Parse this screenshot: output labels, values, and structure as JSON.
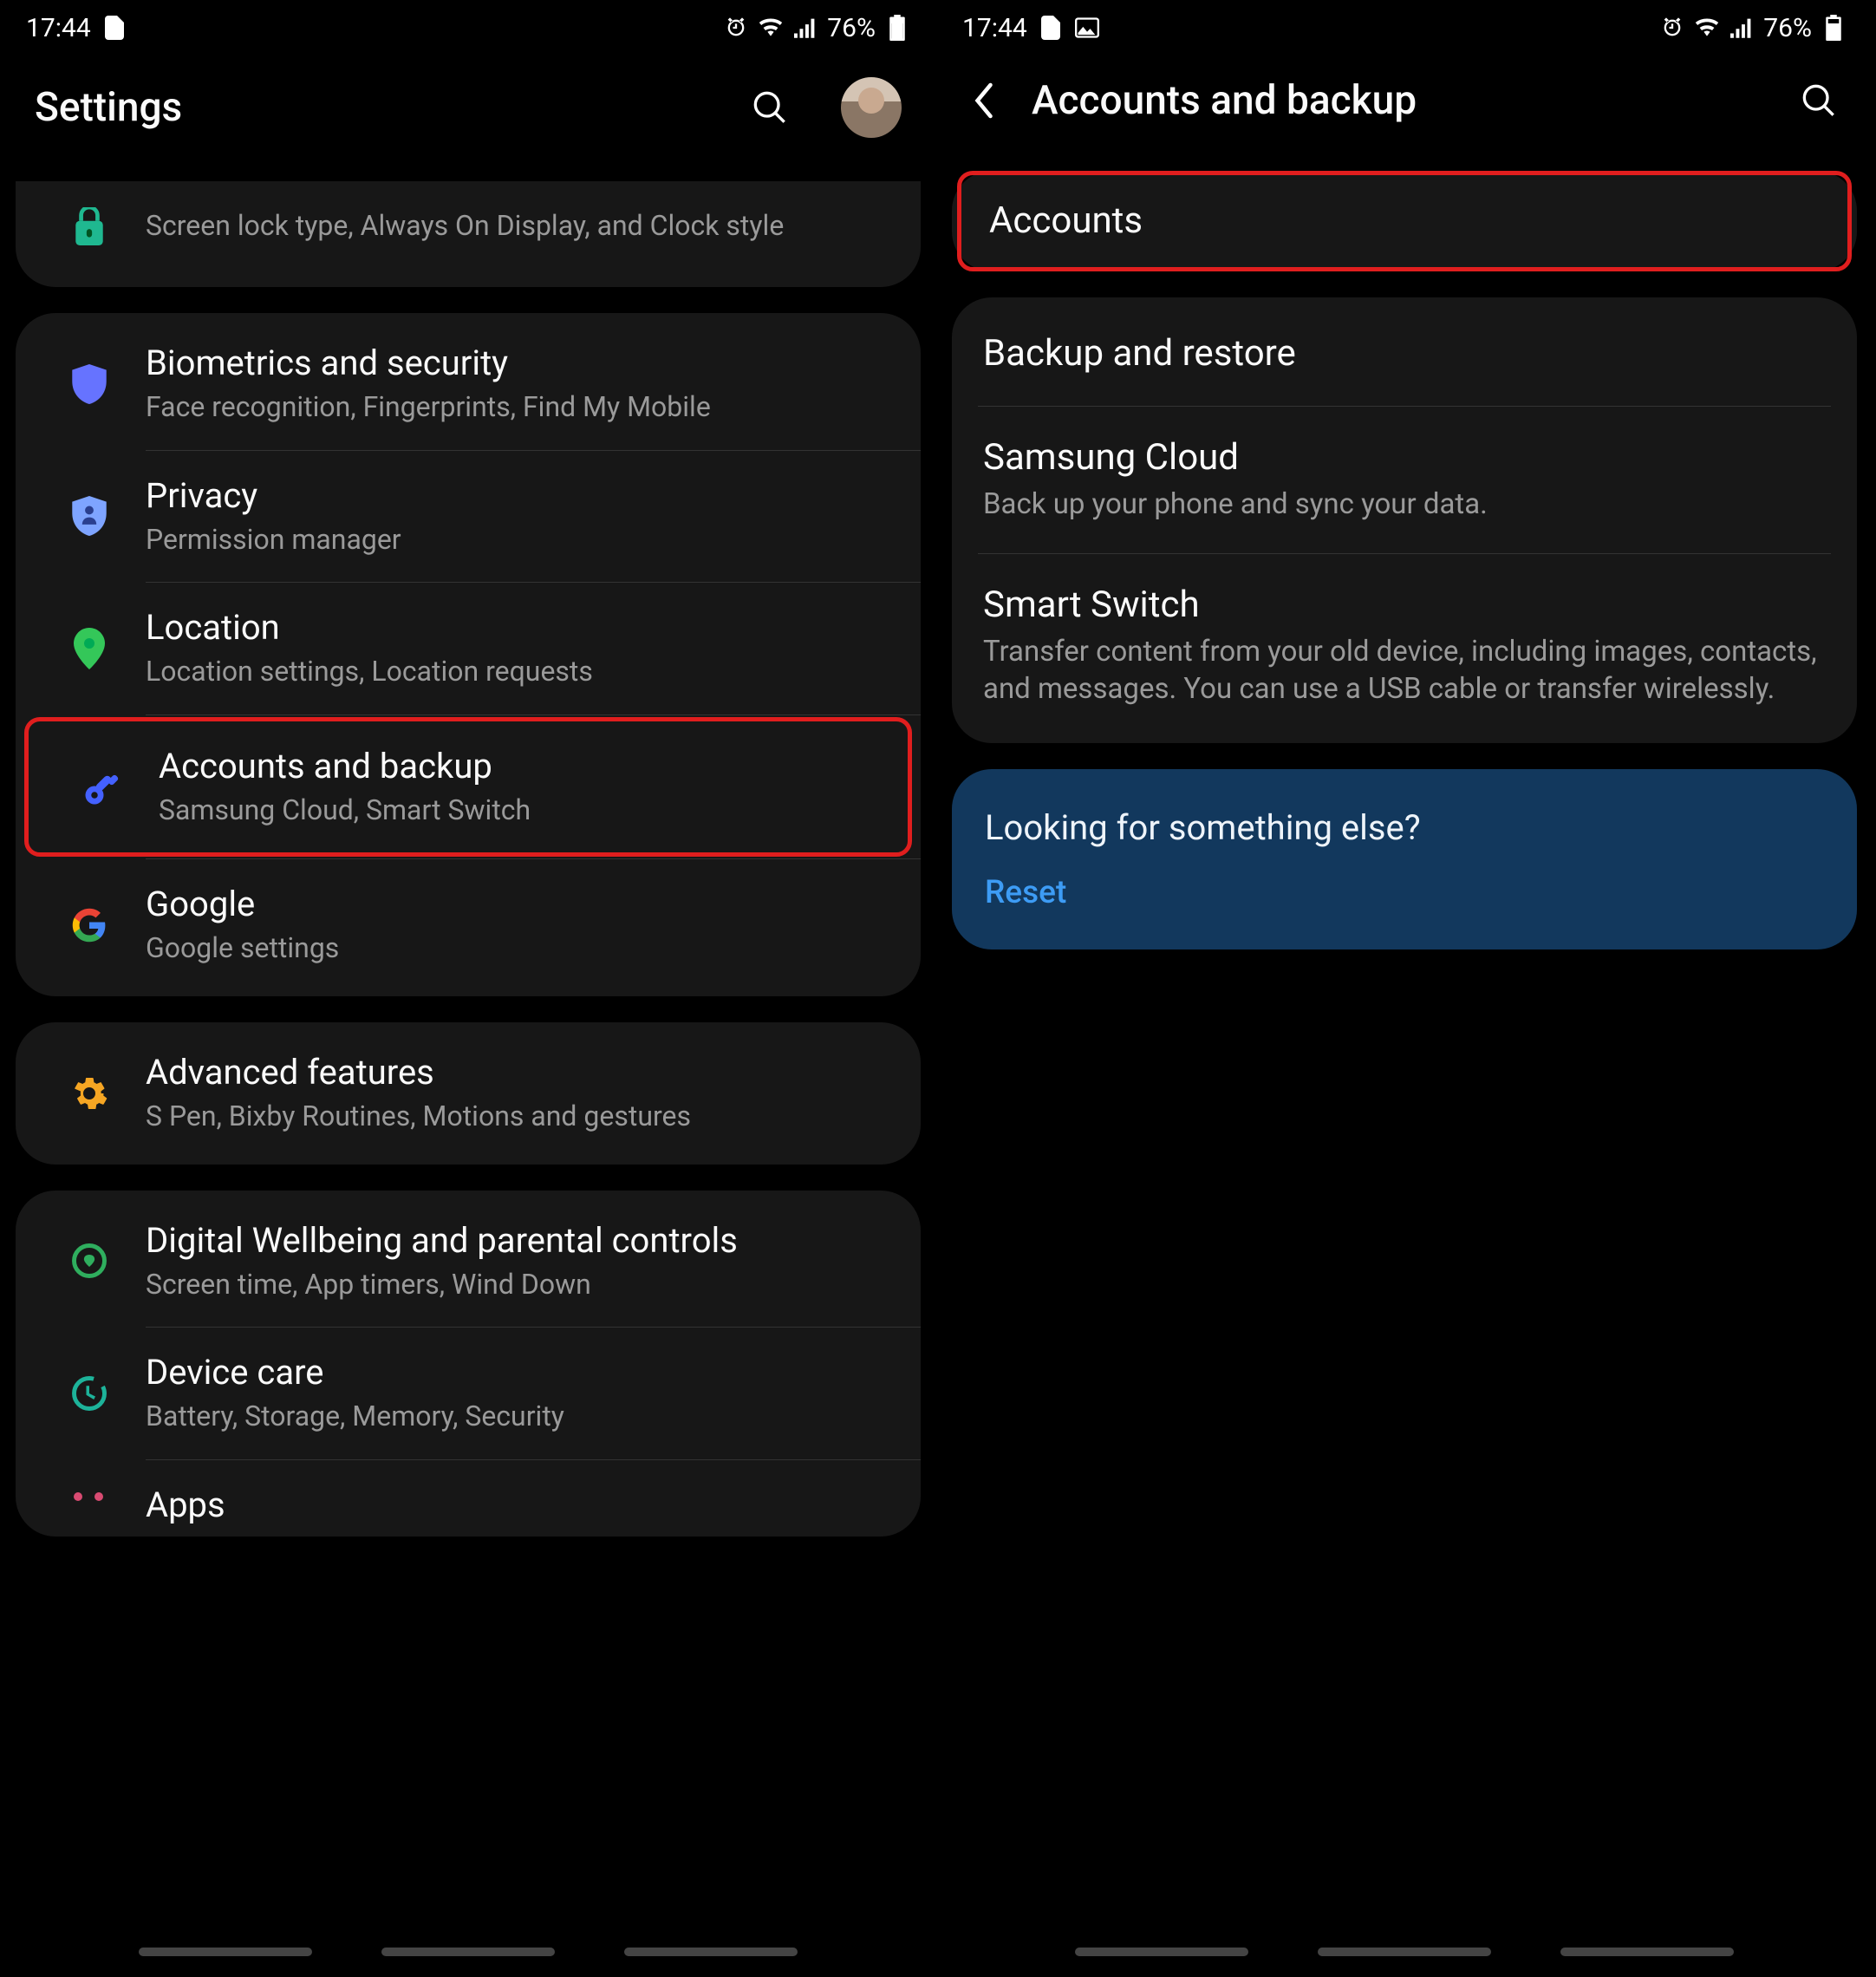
{
  "statusbar": {
    "time": "17:44",
    "battery": "76%"
  },
  "left": {
    "title": "Settings",
    "group0": {
      "lock": {
        "sub": "Screen lock type, Always On Display, and Clock style"
      }
    },
    "group1": {
      "bio": {
        "title": "Biometrics and security",
        "sub": "Face recognition, Fingerprints, Find My Mobile"
      },
      "privacy": {
        "title": "Privacy",
        "sub": "Permission manager"
      },
      "location": {
        "title": "Location",
        "sub": "Location settings, Location requests"
      },
      "accounts": {
        "title": "Accounts and backup",
        "sub": "Samsung Cloud, Smart Switch"
      },
      "google": {
        "title": "Google",
        "sub": "Google settings"
      }
    },
    "group2": {
      "advanced": {
        "title": "Advanced features",
        "sub": "S Pen, Bixby Routines, Motions and gestures"
      }
    },
    "group3": {
      "wellbeing": {
        "title": "Digital Wellbeing and parental controls",
        "sub": "Screen time, App timers, Wind Down"
      },
      "device": {
        "title": "Device care",
        "sub": "Battery, Storage, Memory, Security"
      },
      "apps": {
        "title": "Apps"
      }
    }
  },
  "right": {
    "title": "Accounts and backup",
    "group0": {
      "accounts": {
        "title": "Accounts"
      }
    },
    "group1": {
      "backup": {
        "title": "Backup and restore"
      },
      "cloud": {
        "title": "Samsung Cloud",
        "sub": "Back up your phone and sync your data."
      },
      "switch": {
        "title": "Smart Switch",
        "sub": "Transfer content from your old device, including images, contacts, and messages. You can use a USB cable or transfer wirelessly."
      }
    },
    "tip": {
      "title": "Looking for something else?",
      "link": "Reset"
    }
  }
}
